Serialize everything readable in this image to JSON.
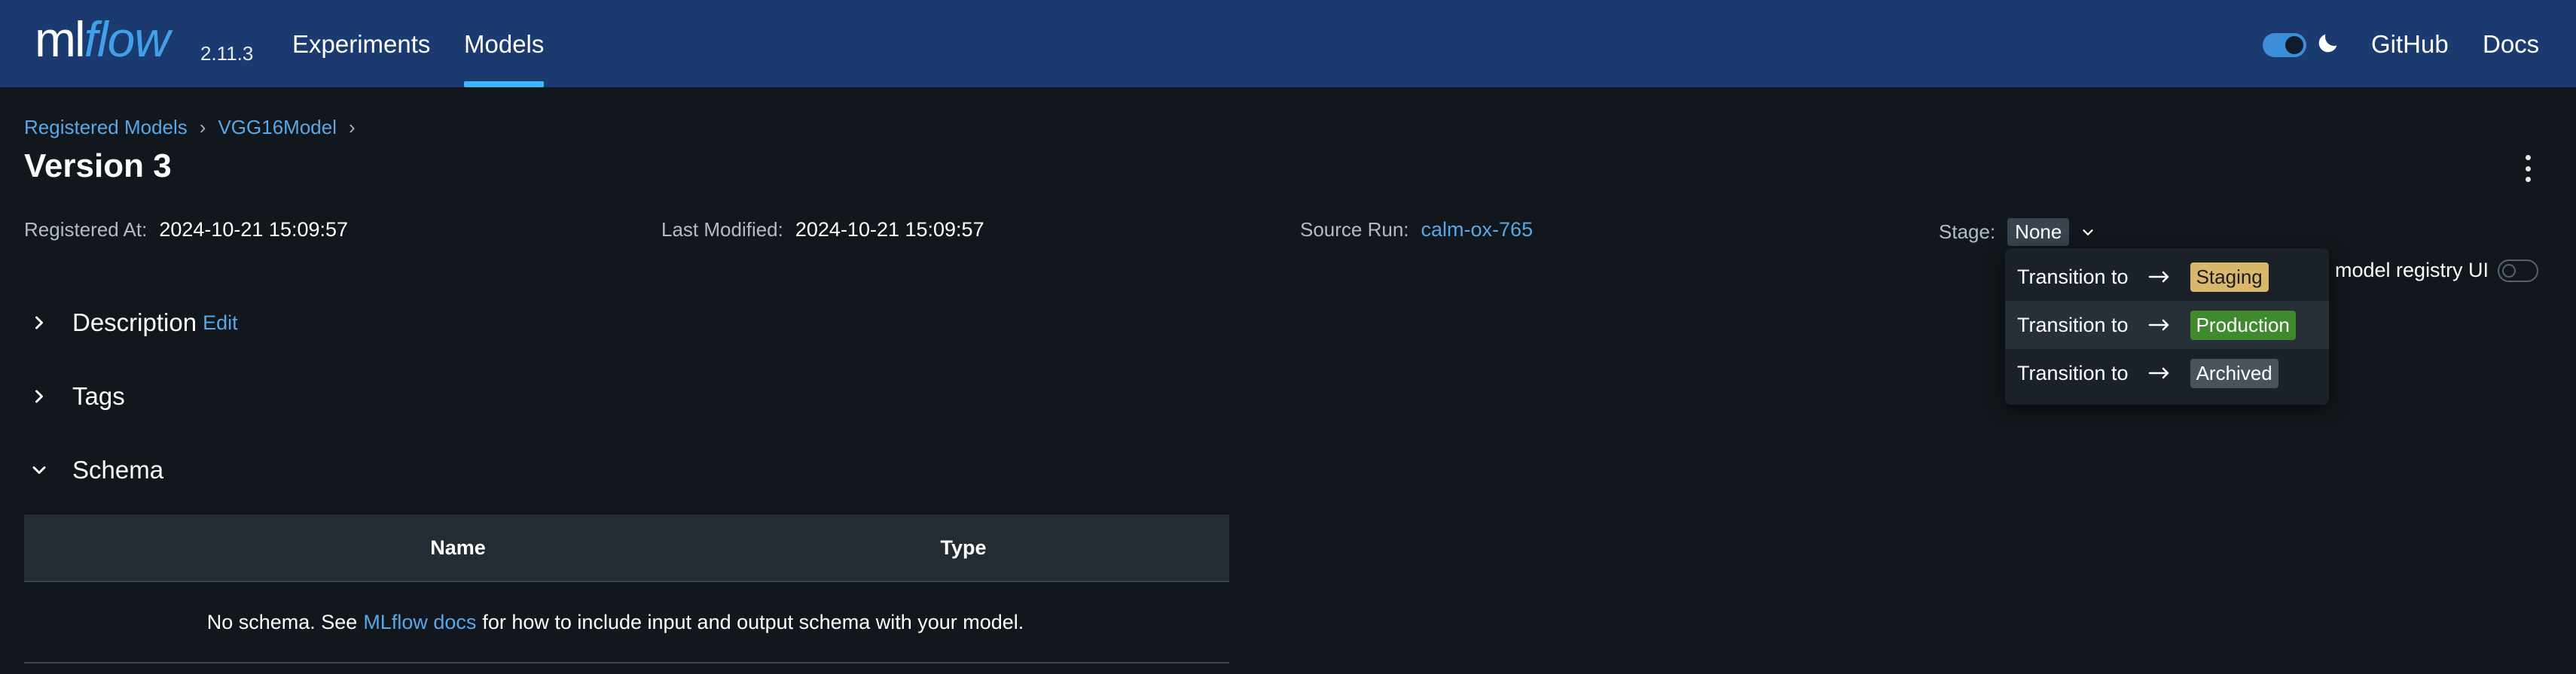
{
  "app": {
    "logo_ml": "ml",
    "logo_flow": "flow",
    "version": "2.11.3"
  },
  "nav": {
    "tabs": [
      "Experiments",
      "Models"
    ],
    "active_tab": "Models",
    "links": [
      "GitHub",
      "Docs"
    ]
  },
  "breadcrumb": [
    "Registered Models",
    "VGG16Model"
  ],
  "page": {
    "title": "Version 3"
  },
  "meta": {
    "registered_label": "Registered At:",
    "registered_value": "2024-10-21 15:09:57",
    "modified_label": "Last Modified:",
    "modified_value": "2024-10-21 15:09:57",
    "source_label": "Source Run:",
    "source_value": "calm-ox-765",
    "stage_label": "Stage:",
    "stage_value": "None"
  },
  "sections": {
    "description": "Description",
    "edit": "Edit",
    "tags": "Tags",
    "schema": "Schema"
  },
  "schema_table": {
    "columns": [
      "Name",
      "Type"
    ],
    "empty_before": "No schema. See",
    "empty_link": "MLflow docs",
    "empty_after": "for how to include input and output schema with your model."
  },
  "registry_toggle_label": "model registry UI",
  "stage_menu": {
    "prefix": "Transition to",
    "options": [
      "Staging",
      "Production",
      "Archived"
    ]
  },
  "colors": {
    "topbar": "#1b3a6f",
    "accent": "#43b5ff",
    "link": "#5aa7e6",
    "staging": "#d9b86c",
    "production": "#3f8a2f",
    "archived": "#4a535c"
  }
}
